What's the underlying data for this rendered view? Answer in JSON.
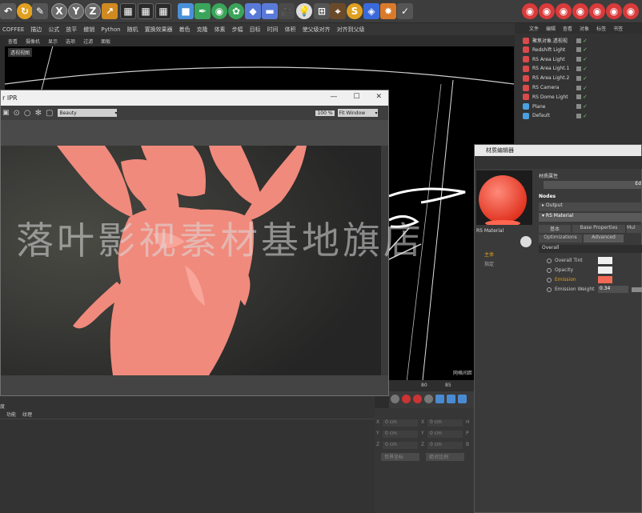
{
  "menubar": [
    "COFFEE",
    "描边",
    "公式",
    "放平",
    "撤销",
    "Python",
    "随机",
    "置换效果器",
    "着色",
    "克隆",
    "体素",
    "步幅",
    "目标",
    "时间",
    "体积",
    "使父级对齐",
    "对齐到父级"
  ],
  "viewport": {
    "menu": [
      "查看",
      "摄像机",
      "显示",
      "选项",
      "过滤",
      "面板"
    ],
    "label": "透视视图",
    "grid_label": "网格间距"
  },
  "object_manager": {
    "menu": [
      "文件",
      "编辑",
      "查看",
      "对象",
      "标签",
      "书签"
    ],
    "items": [
      {
        "name": "聚焦对象.透视视",
        "color": "#d94a4a"
      },
      {
        "name": "Redshift Light",
        "color": "#d94a4a"
      },
      {
        "name": "RS Area Light",
        "color": "#d94a4a"
      },
      {
        "name": "RS Area Light.1",
        "color": "#d94a4a"
      },
      {
        "name": "RS Area Light.2",
        "color": "#d94a4a"
      },
      {
        "name": "RS Camera",
        "color": "#d94a4a"
      },
      {
        "name": "RS Dome Light",
        "color": "#d94a4a"
      },
      {
        "name": "Plane",
        "color": "#4aa0e0"
      },
      {
        "name": "Default",
        "color": "#4aa0e0"
      }
    ]
  },
  "ipr": {
    "title": "r IPR",
    "channel": "Beauty",
    "zoom": "100 %",
    "fit": "Fit Window"
  },
  "material_editor": {
    "title": "材质编辑器",
    "material_name": "RS Material",
    "section_attrs": "材质属性",
    "edit_btn": "Ed",
    "nodes_label": "Nodes",
    "output_node": "Output",
    "rs_node": "RS Material",
    "tabs": [
      "基本",
      "Base Properties",
      "Mul"
    ],
    "tabs2": [
      "Optimizations",
      "Advanced"
    ],
    "group": "Overall",
    "side_labels": [
      "主体",
      "指定"
    ],
    "params": [
      {
        "label": "Overall Tint",
        "color": "#f0f0f0"
      },
      {
        "label": "Opacity",
        "color": "#f0f0f0"
      },
      {
        "label": "Emission",
        "color": "#f06a55",
        "highlight": true
      }
    ],
    "emission_weight_label": "Emission Weight",
    "emission_weight": "0.34"
  },
  "timeline": {
    "ticks": [
      "80",
      "85"
    ]
  },
  "bottom_left": {
    "title": "度",
    "tabs": [
      "功能",
      "纹理"
    ]
  },
  "coords": {
    "rows": [
      {
        "axis": "X",
        "v1": "0 cm",
        "axis2": "X",
        "v2": "0 cm",
        "axis3": "H"
      },
      {
        "axis": "Y",
        "v1": "0 cm",
        "axis2": "Y",
        "v2": "0 cm",
        "axis3": "P"
      },
      {
        "axis": "Z",
        "v1": "0 cm",
        "axis2": "Z",
        "v2": "0 cm",
        "axis3": "B"
      }
    ],
    "dropdown1": "世界坐标",
    "dropdown2": "绝对比例"
  },
  "watermark": "落叶影视素材基地旗店"
}
